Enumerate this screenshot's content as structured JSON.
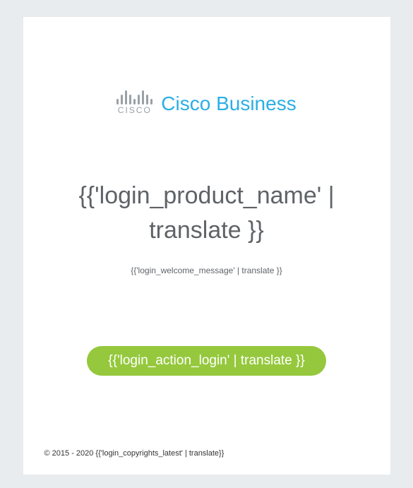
{
  "brand": {
    "logo_word": "CISCO",
    "name": "Cisco Business"
  },
  "main": {
    "product_name": "{{'login_product_name' | translate }}",
    "welcome_message": "{{'login_welcome_message' | translate }}"
  },
  "actions": {
    "login_label": "{{'login_action_login' | translate }}"
  },
  "footer": {
    "copyright": "© 2015 - 2020 {{'login_copyrights_latest' | translate}}"
  }
}
